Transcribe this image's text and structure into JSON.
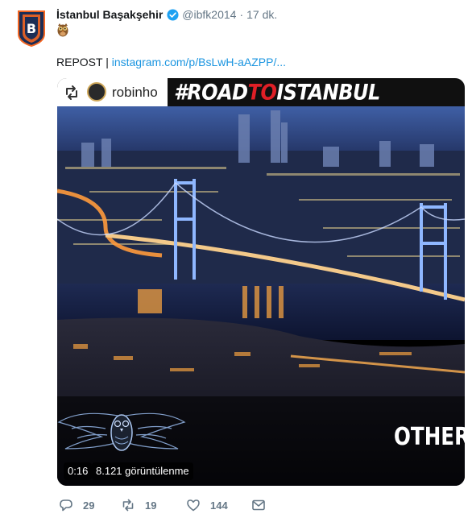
{
  "tweet": {
    "author_name": "İstanbul Başakşehir",
    "handle": "@ibfk2014",
    "separator": "·",
    "time": "17 dk.",
    "emoji_icon": "owl-emoji-icon",
    "text_prefix": "REPOST |",
    "link_text": "instagram.com/p/BsLwH-aAZPP/..."
  },
  "media": {
    "insta_username": "robinho",
    "banner_part1": "#ROAD",
    "banner_part2": "TO",
    "banner_part3": "ISTANBUL",
    "overlay_text": "OTHERS",
    "duration": "0:16",
    "views": "8.121 görüntülenme"
  },
  "actions": {
    "replies": "29",
    "retweets": "19",
    "likes": "144"
  },
  "colors": {
    "link": "#1b95e0",
    "muted": "#657786",
    "verified": "#1da1f2",
    "banner_red": "#e01f26",
    "club_navy": "#1c2d55",
    "club_orange": "#f26522"
  }
}
